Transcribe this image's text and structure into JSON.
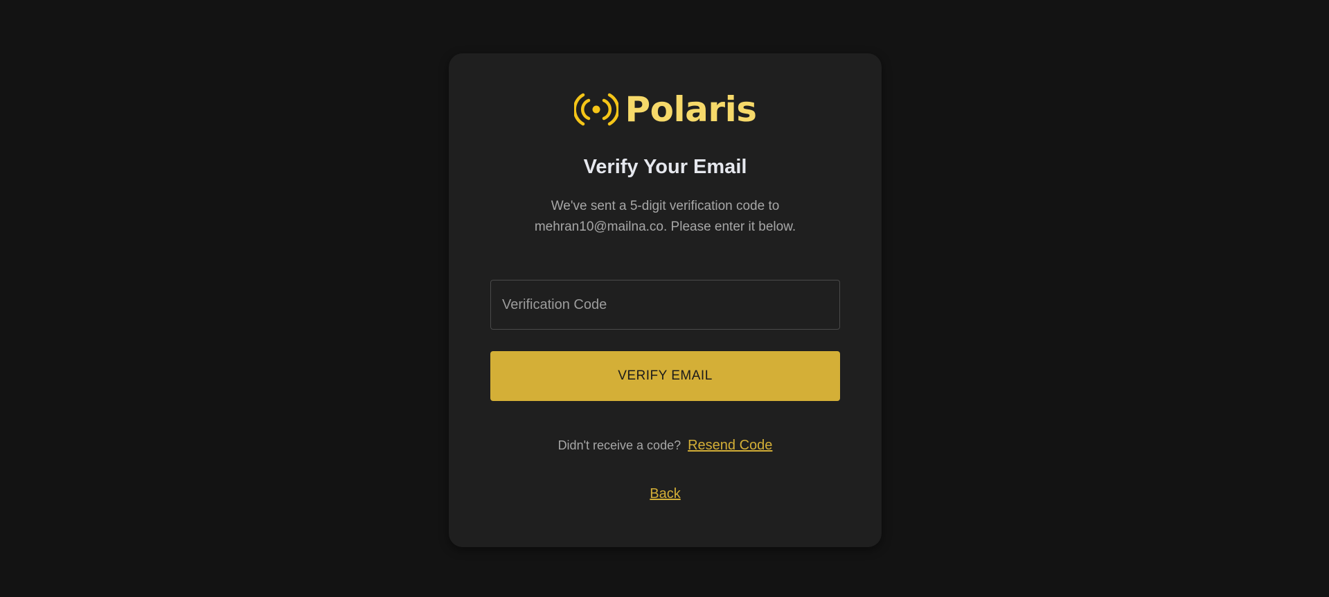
{
  "brand": {
    "name": "Polaris",
    "icon": "broadcast-icon",
    "color": "#f6d96a",
    "icon_color": "#f5c518"
  },
  "page": {
    "title": "Verify Your Email",
    "description": "We've sent a 5-digit verification code to mehran10@mailna.co. Please enter it below."
  },
  "form": {
    "code_placeholder": "Verification Code",
    "code_value": "",
    "submit_label": "VERIFY EMAIL"
  },
  "resend": {
    "prompt": "Didn't receive a code?",
    "link_label": "Resend Code"
  },
  "back_label": "Back",
  "colors": {
    "background": "#131313",
    "card": "#1f1f1f",
    "accent": "#d4af37"
  }
}
